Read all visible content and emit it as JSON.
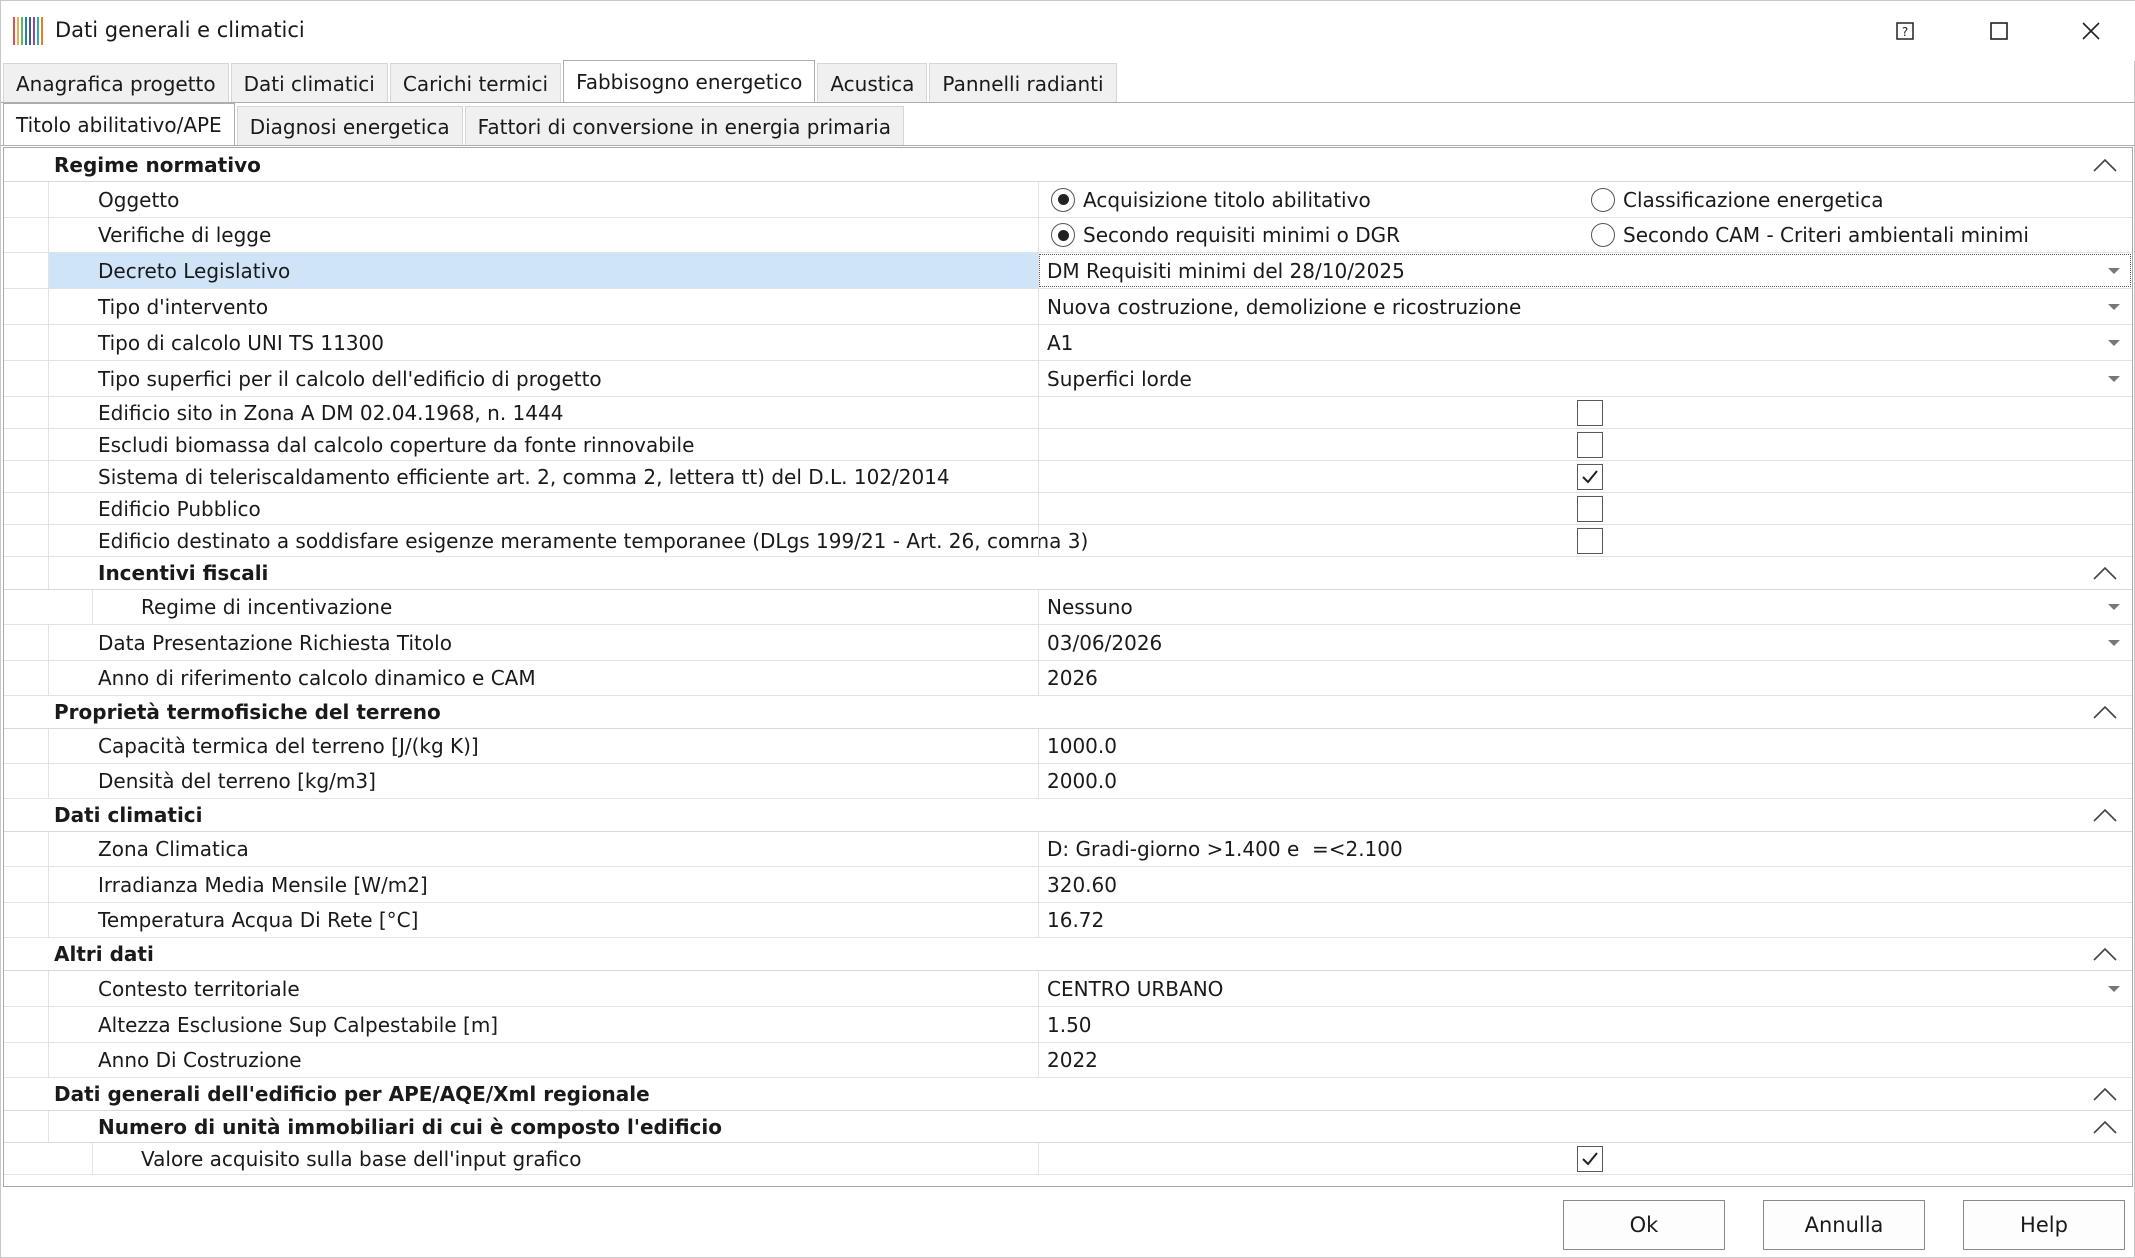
{
  "window": {
    "title": "Dati generali e climatici",
    "icon_colors": [
      "#d9534f",
      "#f0ad4e",
      "#5cb85c",
      "#2a7f9e",
      "#3b5998",
      "#8e44ad",
      "#1abc9c",
      "#e67e22"
    ]
  },
  "tabs": {
    "main": [
      "Anagrafica progetto",
      "Dati climatici",
      "Carichi termici",
      "Fabbisogno energetico",
      "Acustica",
      "Pannelli radianti"
    ],
    "main_active": 3,
    "sub": [
      "Titolo abilitativo/APE",
      "Diagnosi energetica",
      "Fattori di conversione in energia primaria"
    ],
    "sub_active": 0
  },
  "grid": {
    "regime": {
      "title": "Regime normativo",
      "oggetto": {
        "label": "Oggetto",
        "opt1": "Acquisizione titolo abilitativo",
        "opt2": "Classificazione energetica",
        "selected": 1
      },
      "verifiche": {
        "label": "Verifiche di legge",
        "opt1": "Secondo requisiti minimi o DGR",
        "opt2": "Secondo CAM - Criteri ambientali minimi",
        "selected": 1
      },
      "decreto": {
        "label": "Decreto Legislativo",
        "value": "DM Requisiti minimi del 28/10/2025"
      },
      "intervento": {
        "label": "Tipo d'intervento",
        "value": "Nuova costruzione, demolizione e ricostruzione"
      },
      "calcolo": {
        "label": "Tipo di calcolo UNI TS 11300",
        "value": "A1"
      },
      "superfici": {
        "label": "Tipo superfici per il calcolo dell'edificio di progetto",
        "value": "Superfici lorde"
      },
      "zona_a": {
        "label": "Edificio sito in Zona A DM 02.04.1968, n. 1444",
        "checked": false
      },
      "biomassa": {
        "label": "Escludi biomassa dal calcolo coperture da fonte rinnovabile",
        "checked": false
      },
      "teleriscaldamento": {
        "label": "Sistema di teleriscaldamento efficiente art. 2, comma 2, lettera tt) del D.L. 102/2014",
        "checked": true
      },
      "pubblico": {
        "label": "Edificio Pubblico",
        "checked": false
      },
      "temporaneo": {
        "label": "Edificio destinato a soddisfare esigenze meramente temporanee (DLgs 199/21 - Art. 26, comma 3)",
        "checked": false
      },
      "incentivi": {
        "title": "Incentivi fiscali",
        "regime": {
          "label": "Regime di incentivazione",
          "value": "Nessuno"
        }
      },
      "data_presentazione": {
        "label": "Data Presentazione Richiesta Titolo",
        "value": "03/06/2026"
      },
      "anno_riferimento": {
        "label": "Anno di riferimento calcolo dinamico e CAM",
        "value": "2026"
      }
    },
    "terreno": {
      "title": "Proprietà termofisiche del terreno",
      "capacita": {
        "label": "Capacità termica del terreno [J/(kg K)]",
        "value": "1000.0"
      },
      "densita": {
        "label": "Densità del terreno [kg/m3]",
        "value": "2000.0"
      }
    },
    "climatici": {
      "title": "Dati climatici",
      "zona": {
        "label": "Zona Climatica",
        "value": "D: Gradi-giorno >1.400 e  =<2.100"
      },
      "irradianza": {
        "label": "Irradianza Media Mensile [W/m2]",
        "value": "320.60"
      },
      "acqua": {
        "label": "Temperatura Acqua Di Rete [°C]",
        "value": "16.72"
      }
    },
    "altri": {
      "title": "Altri dati",
      "contesto": {
        "label": "Contesto territoriale",
        "value": "CENTRO URBANO"
      },
      "altezza": {
        "label": "Altezza Esclusione Sup Calpestabile [m]",
        "value": "1.50"
      },
      "anno": {
        "label": "Anno Di Costruzione",
        "value": "2022"
      }
    },
    "ape": {
      "title": "Dati generali dell'edificio per APE/AQE/Xml regionale",
      "unita": {
        "title": "Numero di unità immobiliari di cui è composto l'edificio",
        "valore": {
          "label": "Valore acquisito sulla base dell'input grafico",
          "checked": true
        }
      }
    }
  },
  "buttons": {
    "ok": "Ok",
    "annulla": "Annulla",
    "help": "Help"
  }
}
